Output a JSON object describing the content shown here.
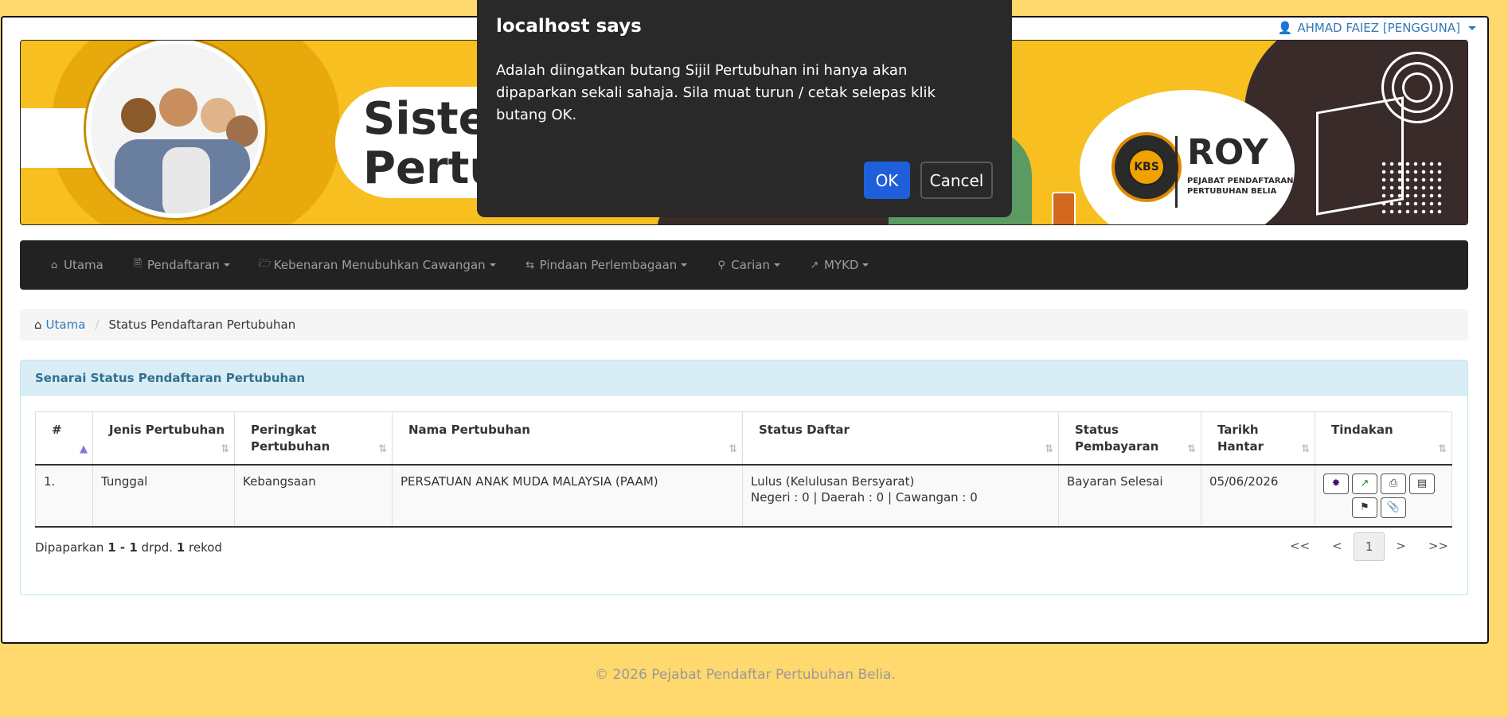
{
  "user_menu": {
    "label": "AHMAD FAIEZ [PENGGUNA]",
    "icon": "user-icon"
  },
  "banner": {
    "title_line1": "Sister",
    "title_line2": "Pertu",
    "logo_text": "ROY",
    "logo_sub": "PEJABAT PENDAFTARAN PERTUBUHAN BELIA",
    "kbs": "KBS"
  },
  "nav": {
    "items": [
      {
        "label": "Utama",
        "icon": "home-icon",
        "dropdown": false
      },
      {
        "label": "Pendaftaran",
        "icon": "file-icon",
        "dropdown": true
      },
      {
        "label": "Kebenaran Menubuhkan Cawangan",
        "icon": "folder-open-icon",
        "dropdown": true
      },
      {
        "label": "Pindaan Perlembagaan",
        "icon": "transfer-icon",
        "dropdown": true
      },
      {
        "label": "Carian",
        "icon": "search-icon",
        "dropdown": true
      },
      {
        "label": "MYKD",
        "icon": "external-link-icon",
        "dropdown": true
      }
    ]
  },
  "breadcrumb": {
    "home": "Utama",
    "current": "Status Pendaftaran Pertubuhan"
  },
  "panel": {
    "heading": "Senarai Status Pendaftaran Pertubuhan"
  },
  "table": {
    "headers": [
      "#",
      "Jenis Pertubuhan",
      "Peringkat Pertubuhan",
      "Nama Pertubuhan",
      "Status Daftar",
      "Status Pembayaran",
      "Tarikh Hantar",
      "Tindakan"
    ],
    "rows": [
      {
        "no": "1.",
        "jenis": "Tunggal",
        "peringkat": "Kebangsaan",
        "nama": "PERSATUAN ANAK MUDA MALAYSIA (PAAM)",
        "status_line1": "Lulus (Kelulusan Bersyarat)",
        "status_line2": "Negeri : 0 | Daerah : 0 | Cawangan : 0",
        "pembayaran": "Bayaran Selesai",
        "tarikh": "05/06/2026"
      }
    ]
  },
  "info": {
    "prefix": "Dipaparkan ",
    "from": "1",
    "dash": " - ",
    "to": "1",
    "mid": " drpd. ",
    "total": "1",
    "suffix": " rekod"
  },
  "pager": {
    "first": "<<",
    "prev": "<",
    "page": "1",
    "next": ">",
    "last": ">>"
  },
  "footer": {
    "copyright": "© 2026 Pejabat Pendaftar Pertubuhan Belia."
  },
  "dialog": {
    "title": "localhost says",
    "message": "Adalah diingatkan butang Sijil Pertubuhan ini hanya akan dipaparkan sekali sahaja. Sila muat turun / cetak selepas klik butang OK.",
    "ok": "OK",
    "cancel": "Cancel"
  },
  "colors": {
    "page_bg": "#ffd96e",
    "navbar": "#222222",
    "panel_heading": "#d9edf7",
    "link": "#337ab7",
    "ok_button": "#1f5fdc",
    "dialog_bg": "#292929"
  }
}
